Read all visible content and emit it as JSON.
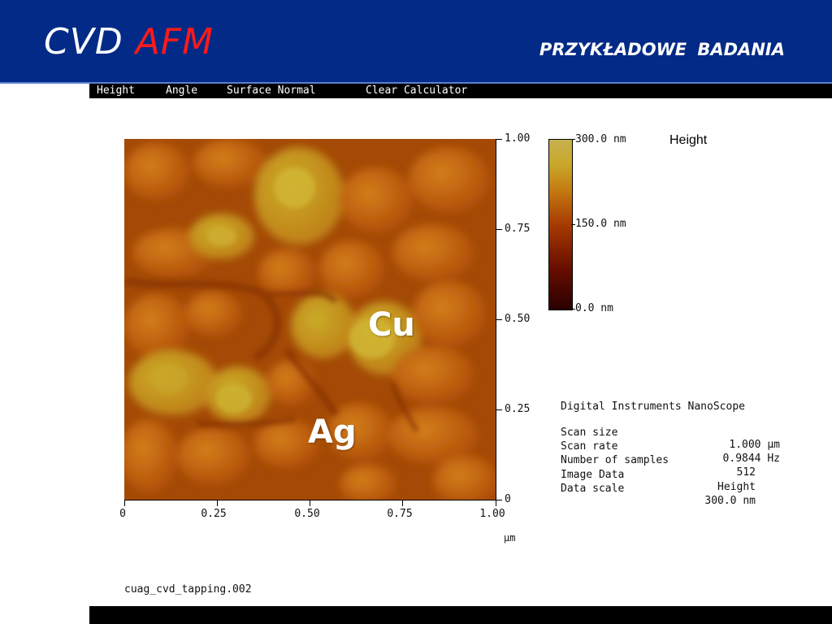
{
  "header": {
    "brand_part1": "CVD",
    "brand_part2": "AFM",
    "section_title": "PRZYKŁADOWE  BADANIA",
    "colors": {
      "background": "#022a86",
      "brand_accent": "#ff1a1a"
    }
  },
  "menu": {
    "items": [
      {
        "label": "Height"
      },
      {
        "label": "Angle"
      },
      {
        "label": "Surface Normal"
      },
      {
        "label": "Clear Calculator"
      }
    ]
  },
  "image": {
    "y_ticks": [
      "1.00",
      "0.75",
      "0.50",
      "0.25",
      "0"
    ],
    "x_ticks": [
      "0",
      "0.25",
      "0.50",
      "0.75",
      "1.00"
    ],
    "x_unit": "µm",
    "labels": {
      "cu": "Cu",
      "ag": "Ag"
    }
  },
  "colorbar": {
    "title": "Height",
    "ticks": [
      "300.0 nm",
      "150.0 nm",
      "0.0 nm"
    ]
  },
  "info": {
    "header": "Digital Instruments NanoScope",
    "rows": [
      {
        "key": "Scan size",
        "value": "1.000 µm"
      },
      {
        "key": "Scan rate",
        "value": "0.9844 Hz"
      },
      {
        "key": "Number of samples",
        "value": "512"
      },
      {
        "key": "Image Data",
        "value": "Height"
      },
      {
        "key": "Data scale",
        "value": "300.0 nm"
      }
    ]
  },
  "filename": "cuag_cvd_tapping.002"
}
